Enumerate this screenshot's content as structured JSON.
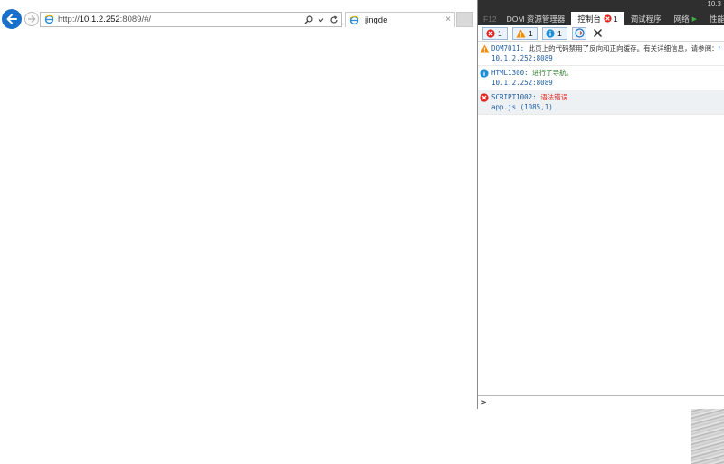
{
  "browser": {
    "url_prefix": "http://",
    "url_host": "10.1.2.252",
    "url_rest": ":8089/#/",
    "tab_title": "jingde",
    "tab_close": "×"
  },
  "devtools": {
    "version": "10.3",
    "tabs": [
      {
        "label": "F12"
      },
      {
        "label": "DOM 资源管理器"
      },
      {
        "label": "控制台",
        "badge": "1"
      },
      {
        "label": "调试程序"
      },
      {
        "label": "网络"
      },
      {
        "label": "性能"
      }
    ],
    "filters": {
      "errors": "1",
      "warnings": "1",
      "info": "1"
    },
    "messages": [
      {
        "level": "warning",
        "code": "DOM7011",
        "text": "此页上的代码禁用了反向和正向缓存。有关详细信息，请参阅：",
        "link": "ht",
        "source": "10.1.2.252:8089"
      },
      {
        "level": "info",
        "code": "HTML1300",
        "text": "进行了导航。",
        "source": "10.1.2.252:8089"
      },
      {
        "level": "error",
        "code": "SCRIPT1002",
        "text": "语法错误",
        "source": "app.js (1085,1)"
      }
    ],
    "prompt": ">"
  },
  "colors": {
    "back_button": "#1a6fc9",
    "devtools_tabbar": "#2f2f2f",
    "error": "#e0261f",
    "warning": "#f08a00",
    "info": "#1e8fd6",
    "source_link": "#1f5d9e"
  }
}
